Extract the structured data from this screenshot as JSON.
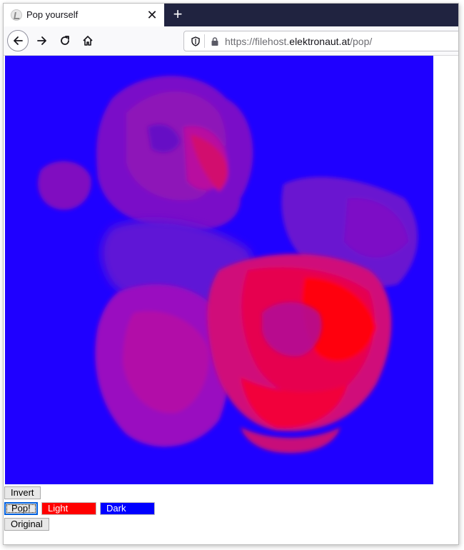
{
  "browser": {
    "tab": {
      "title": "Pop yourself",
      "close_glyph": "✕"
    },
    "new_tab_glyph": "+",
    "url": {
      "prefix": "https://filehost.",
      "host": "elektronaut.at",
      "path": "/pop/"
    }
  },
  "icons": {
    "favicon": "favicon-icon",
    "back": "back-arrow-icon",
    "forward": "forward-arrow-icon",
    "reload": "reload-icon",
    "home": "home-icon",
    "shield": "shield-icon",
    "lock": "lock-icon"
  },
  "controls": {
    "invert_label": "Invert",
    "pop_label": "Pop!",
    "light_color_label": "Light color",
    "dark_color_label": "Dark color",
    "original_label": "Original"
  },
  "colors": {
    "light_color": "#ff0000",
    "dark_color": "#0000ff",
    "photo_background": "#1f00ff",
    "tabstrip": "#202340"
  }
}
